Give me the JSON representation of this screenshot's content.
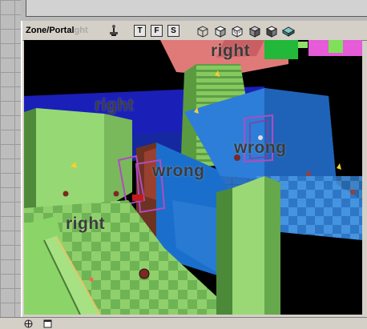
{
  "viewport": {
    "title": "Zone/Portal",
    "title_ghost": "ght",
    "toolbar_buttons": [
      "T",
      "F",
      "S"
    ]
  },
  "scene_labels": {
    "top_right": "right",
    "left_right": "right",
    "blue_wrong": "wrong",
    "center_wrong": "wrong",
    "bottom_right": "right"
  },
  "icons": {
    "actor": "actor-icon",
    "view_modes": [
      "wireframe-cube-icon",
      "zone-cube-icon",
      "brush-cube-icon",
      "solid-cube-icon",
      "lit-cube-icon",
      "texture-cube-icon"
    ],
    "status": [
      "globe-icon",
      "window-icon"
    ]
  },
  "colors": {
    "green_light": "#9ee07a",
    "green_dark": "#5fa84a",
    "blue_room": "#2a72c8",
    "blue_floor": "#3f8fe0",
    "pink": "#e87c80",
    "brown_portal": "#7a3a28"
  }
}
